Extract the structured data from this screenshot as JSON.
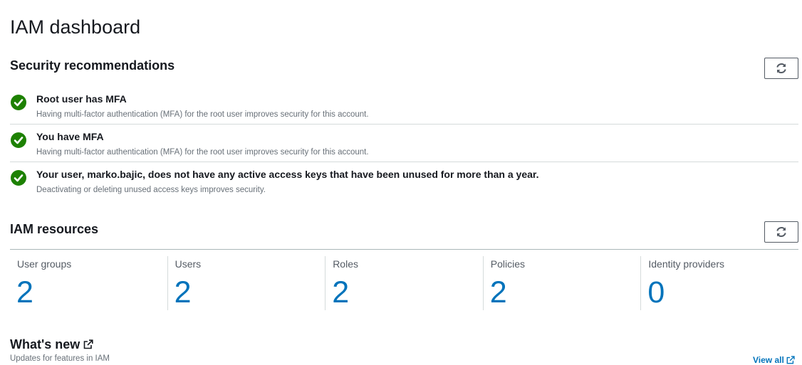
{
  "page": {
    "title": "IAM dashboard"
  },
  "security": {
    "title": "Security recommendations",
    "refresh_icon": "refresh-icon",
    "items": [
      {
        "icon": "check-circle-icon",
        "title": "Root user has MFA",
        "description": "Having multi-factor authentication (MFA) for the root user improves security for this account."
      },
      {
        "icon": "check-circle-icon",
        "title": "You have MFA",
        "description": "Having multi-factor authentication (MFA) for the root user improves security for this account."
      },
      {
        "icon": "check-circle-icon",
        "title": "Your user, marko.bajic, does not have any active access keys that have been unused for more than a year.",
        "description": "Deactivating or deleting unused access keys improves security."
      }
    ]
  },
  "resources": {
    "title": "IAM resources",
    "refresh_icon": "refresh-icon",
    "items": [
      {
        "label": "User groups",
        "count": "2"
      },
      {
        "label": "Users",
        "count": "2"
      },
      {
        "label": "Roles",
        "count": "2"
      },
      {
        "label": "Policies",
        "count": "2"
      },
      {
        "label": "Identity providers",
        "count": "0"
      }
    ]
  },
  "whats_new": {
    "title": "What's new",
    "icon": "external-link-icon",
    "subtitle": "Updates for features in IAM",
    "view_all": "View all"
  },
  "colors": {
    "success": "#1d8102",
    "link": "#0073bb",
    "text": "#16191f",
    "muted": "#687078"
  }
}
